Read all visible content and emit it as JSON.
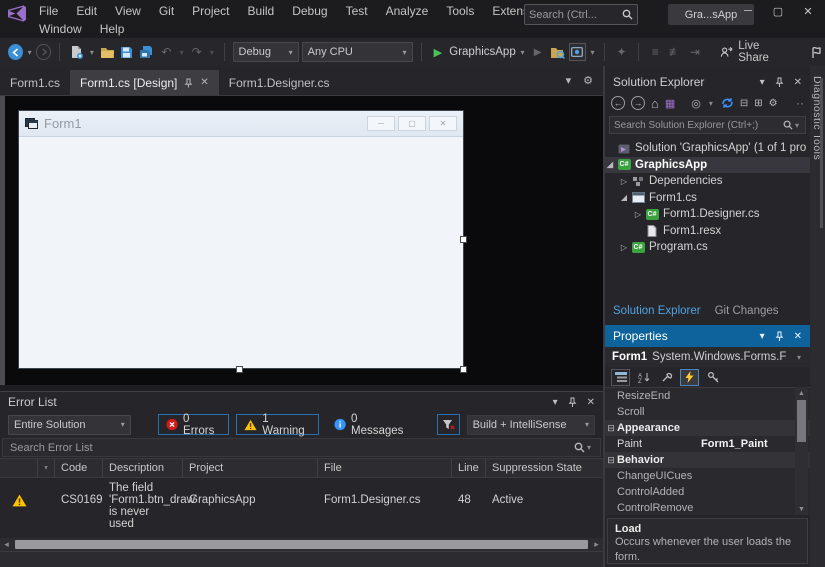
{
  "colors": {
    "accent_blue": "#007ACC",
    "panel_header_blue": "#0E639C",
    "link_blue": "#4FA3E3",
    "warning_yellow": "#FDC300",
    "error_red": "#D11B1B",
    "info_blue": "#3794FF",
    "run_green": "#3CB44A",
    "form_body": "#F1F5FA"
  },
  "titlebar": {
    "menu_row1": [
      "File",
      "Edit",
      "View",
      "Git",
      "Project",
      "Build",
      "Debug",
      "Test",
      "Analyze",
      "Tools",
      "Extensions"
    ],
    "menu_row2": [
      "Window",
      "Help"
    ],
    "search_placeholder": "Search (Ctrl...",
    "window_title": "Gra...sApp"
  },
  "toolbar": {
    "configuration": "Debug",
    "platform": "Any CPU",
    "startup_project": "GraphicsApp",
    "live_share_label": "Live Share"
  },
  "editor_tabs": {
    "tab1": "Form1.cs",
    "tab2": "Form1.cs [Design]",
    "tab3": "Form1.Designer.cs"
  },
  "designer": {
    "form_title": "Form1"
  },
  "solution_explorer": {
    "title": "Solution Explorer",
    "search_placeholder": "Search Solution Explorer (Ctrl+;)",
    "tree": [
      {
        "label": "Solution 'GraphicsApp' (1 of 1 pro"
      },
      {
        "label": "GraphicsApp"
      },
      {
        "label": "Dependencies"
      },
      {
        "label": "Form1.cs"
      },
      {
        "label": "Form1.Designer.cs"
      },
      {
        "label": "Form1.resx"
      },
      {
        "label": "Program.cs"
      }
    ],
    "bottom_tabs": {
      "solution_explorer": "Solution Explorer",
      "git_changes": "Git Changes"
    }
  },
  "properties_panel": {
    "title": "Properties",
    "object_name": "Form1",
    "object_type": "System.Windows.Forms.F",
    "grid": [
      {
        "name": "ResizeEnd",
        "value": ""
      },
      {
        "name": "Scroll",
        "value": ""
      },
      {
        "name": "Appearance",
        "value": ""
      },
      {
        "name": "Paint",
        "value": "Form1_Paint"
      },
      {
        "name": "Behavior",
        "value": ""
      },
      {
        "name": "ChangeUICues",
        "value": ""
      },
      {
        "name": "ControlAdded",
        "value": ""
      },
      {
        "name": "ControlRemove",
        "value": ""
      }
    ],
    "description_title": "Load",
    "description_text": "Occurs whenever the user loads the form."
  },
  "error_list": {
    "title": "Error List",
    "scope": "Entire Solution",
    "errors_toggle": "0 Errors",
    "warnings_toggle": "1 Warning",
    "messages_toggle": "0 Messages",
    "source_filter": "Build + IntelliSense",
    "search_placeholder": "Search Error List",
    "columns": {
      "code": "Code",
      "description": "Description",
      "project": "Project",
      "file": "File",
      "line": "Line",
      "suppression": "Suppression State"
    },
    "row": {
      "code": "CS0169",
      "description": "The field 'Form1.btn_draw' is never used",
      "project": "GraphicsApp",
      "file": "Form1.Designer.cs",
      "line": "48",
      "suppression": "Active"
    }
  },
  "right_edge": {
    "diagnostic_tools_tab": "Diagnostic Tools"
  },
  "icons": {
    "chevron_down": "▾",
    "close": "✕",
    "minimize": "─",
    "maximize": "▢",
    "gear": "⚙",
    "undo": "↶",
    "redo": "↷",
    "home": "⌂",
    "back_arrow": "←",
    "forward_arrow": "→",
    "overflow": "··",
    "collapsed": "▷",
    "expanded": "◢",
    "category_box": "⊟",
    "up": "▲",
    "down": "▼",
    "left": "◂",
    "right": "▸",
    "play": "▶",
    "scope": "◎",
    "views": "▦",
    "collapse_all": "⊟"
  }
}
